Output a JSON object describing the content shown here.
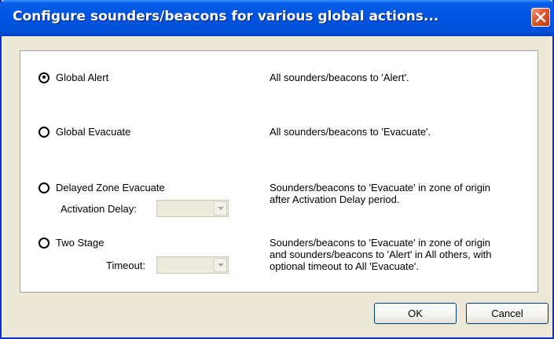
{
  "dialog": {
    "title": "Configure sounders/beacons for various global actions...",
    "close_icon": "close-icon"
  },
  "options": [
    {
      "label": "Global Alert",
      "selected": true,
      "description": "All sounders/beacons to 'Alert'."
    },
    {
      "label": "Global Evacuate",
      "selected": false,
      "description": "All sounders/beacons to 'Evacuate'."
    },
    {
      "label": "Delayed Zone Evacuate",
      "selected": false,
      "description": "Sounders/beacons to 'Evacuate' in zone of origin\nafter Activation Delay period.",
      "sub_label": "Activation Delay:",
      "sub_value": ""
    },
    {
      "label": "Two Stage",
      "selected": false,
      "description": "Sounders/beacons to 'Evacuate' in zone of origin\nand sounders/beacons to 'Alert' in All others, with\noptional timeout to All 'Evacuate'.",
      "sub_label": "Timeout:",
      "sub_value": ""
    }
  ],
  "buttons": {
    "ok": "OK",
    "cancel": "Cancel"
  },
  "colors": {
    "titlebar": "#0054e3",
    "face": "#ece9d8",
    "close": "#e35a2f"
  }
}
